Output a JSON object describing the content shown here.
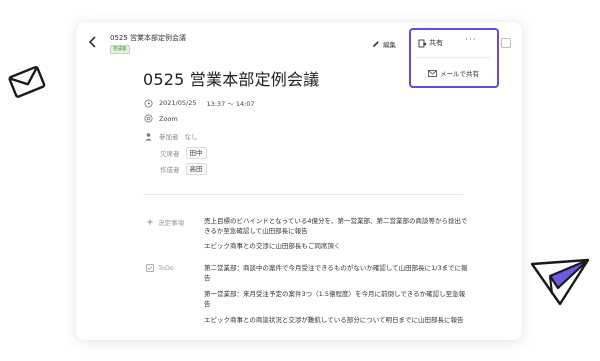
{
  "colors": {
    "accent": "#5b4ee0",
    "badge_green": "#3a8f3a"
  },
  "header": {
    "title": "0525 営業本部定例会議",
    "badge": "完成版",
    "edit_label": "編集",
    "share_label": "共有",
    "more_label": "···"
  },
  "share_menu": {
    "email_label": "メールで共有"
  },
  "document": {
    "title": "0525 営業本部定例会議",
    "date": "2021/05/25",
    "time": "13:37 〜 14:07",
    "location": "Zoom",
    "participants_label": "参加者",
    "participants_value": "なし",
    "absent_label": "欠席者",
    "absent_value": "田中",
    "author_label": "作成者",
    "author_value": "高田"
  },
  "sections": {
    "decisions": {
      "label": "決定事項",
      "items": [
        "売上目標のビハインドとなっている4億分を、第一営業部、第二営業部の商談等から捻出できるか至急確認して山田部長に報告",
        "エピック商事との交渉に山田部長もご同席頂く"
      ]
    },
    "todo": {
      "label": "ToDo",
      "items": [
        "第二営業部：商談中の案件で今月受注できるものがないか確認して山田部長に1/3までに報告",
        "第一営業部：来月受注予定の案件3つ（1.5億程度）を今月に前倒しできるか確認し至急報告",
        "エピック商事との商談状況と交渉が難航している部分について明日までに山田部長に報告"
      ]
    }
  }
}
